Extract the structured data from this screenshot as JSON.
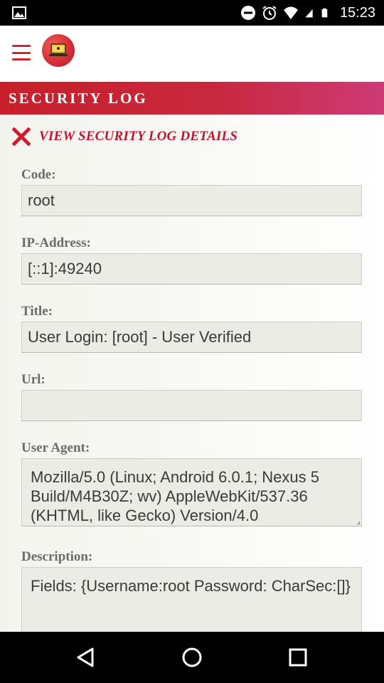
{
  "status_bar": {
    "time": "15:23",
    "icons": [
      "image-icon",
      "do-not-disturb-icon",
      "alarm-icon",
      "wifi-icon",
      "signal-icon",
      "battery-icon"
    ]
  },
  "app_header": {
    "menu_icon": "hamburger-menu-icon",
    "logo_icon": "laptop-logo-icon",
    "accent_color": "#d02530"
  },
  "page": {
    "section_title": "SECURITY LOG",
    "view_title": "VIEW SECURITY LOG DETAILS",
    "close_icon": "close-icon"
  },
  "fields": {
    "code": {
      "label": "Code:",
      "value": "root"
    },
    "ip_address": {
      "label": "IP-Address:",
      "value": "[::1]:49240"
    },
    "title": {
      "label": "Title:",
      "value": "User Login: [root] - User Verified"
    },
    "url": {
      "label": "Url:",
      "value": ""
    },
    "user_agent": {
      "label": "User Agent:",
      "value": "Mozilla/5.0 (Linux; Android 6.0.1; Nexus 5 Build/M4B30Z; wv) AppleWebKit/537.36 (KHTML, like Gecko) Version/4.0"
    },
    "description": {
      "label": "Description:",
      "value": "Fields: {Username:root Password: CharSec:[]}"
    }
  },
  "nav_bar": {
    "icons": [
      "back-icon",
      "home-icon",
      "recents-icon"
    ]
  }
}
